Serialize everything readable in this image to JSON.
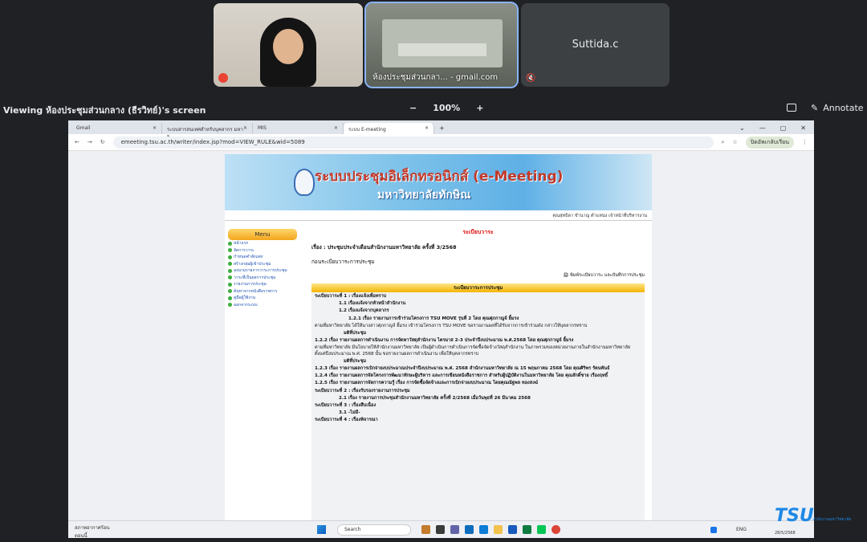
{
  "meet": {
    "tile2_name": "ห้องประชุมส่วนกลา... - gmail.com",
    "tile3_name": "Suttida.c",
    "viewing_text": "Viewing ห้องประชุมส่วนกลาง (ธีรวิทย์)'s screen",
    "zoom_minus": "−",
    "zoom_level": "100%",
    "zoom_plus": "+",
    "annotate_label": "Annotate"
  },
  "browser": {
    "tabs": [
      {
        "label": "Gmail",
        "close": "×"
      },
      {
        "label": "ระบบสารสนเทศสำหรับบุคลากร มหาวิ",
        "close": "×"
      },
      {
        "label": "MIS",
        "close": "×"
      },
      {
        "label": "ระบบ E-meeting",
        "close": "×"
      }
    ],
    "new_tab": "+",
    "win_controls": [
      "⌄",
      "—",
      "▢",
      "✕"
    ],
    "url": "emeeting.tsu.ac.th/writer/index.jsp?mod=VIEW_RULE&wid=5089",
    "profile_pill": "ปิดอัพเกลับเรียน"
  },
  "site": {
    "banner_title": "ระบบประชุมอิเล็กทรอนิกส์ (e-Meeting)",
    "banner_sub": "มหาวิทยาลัยทักษิณ",
    "user_line": "คุณสุทธิดา ชำนาญ ตำแหน่ง เจ้าหน้าที่บริหารงาน",
    "menu_title": "Menu",
    "menu_items": [
      "หน้าแรก",
      "จัดการวาระ",
      "กำหนดคำสั่งแต่ง",
      "สร้างกลุ่มผู้เข้าประชุม",
      "ลงนามรายการวาระการประชุม",
      "วาระที่เป็นผลการประชุม",
      "รายงานการประชุม",
      "ค้นหาจากหนังสือราชการ",
      "คู่มือผู้ใช้งาน",
      "ออกจากระบบ"
    ],
    "page_title": "ระเบียบวาระ",
    "subject": "เรื่อง : ประชุมประจำเดือนสำนักงานมหาวิทยาลัย ครั้งที่ 3/2568",
    "before_agenda": "ก่อนระเบียบวาระการประชุม",
    "print_link": "พิมพ์ระเบียบวาระ และบันทึกการประชุม",
    "agenda_header": "ระเบียบวาระการประชุม",
    "agenda": [
      {
        "text": "ระเบียบวาระที่ 1 : เรื่องแจ้งเพื่อทราบ",
        "indent": 0,
        "bold": true
      },
      {
        "text": "1.1 เรื่องแจ้งจากหัวหน้าสำนักงาน",
        "indent": 30,
        "bold": true
      },
      {
        "text": "1.2 เรื่องแจ้งจากบุคลากร",
        "indent": 30,
        "bold": true
      },
      {
        "text": "1.2.1 เรื่อง รายงานการเข้าร่วมโครงการ TSU MOVE รุ่นที่ 2 โดย คุณศุภกาญจ์ ยิ้มรง",
        "indent": 42,
        "bold": true
      },
      {
        "text": "ตามที่มหาวิทยาลัย ได้ให้นางสาวศุภกาญจ์ ยิ้มรง เข้าร่วมโครงการ TSU MOVE ขอรายงานผลที่ได้รับจากการเข้าร่วมดัง กล่าวให้บุคลากรทราบ",
        "indent": 0,
        "bold": false
      },
      {
        "text": "มติที่ประชุม",
        "indent": 36,
        "bold": true
      },
      {
        "text": "1.2.2 เรื่อง รายงานผลการดำเนินงาน การจัดหาวัสดุสำนักงาน ไตรมาส 2-3 ประจำปีงบประมาณ พ.ศ.2568 โดย คุณศุภกาญจ์ ยิ้มรง",
        "indent": 0,
        "bold": true
      },
      {
        "text": "ตามที่มหาวิทยาลัย มีนโยบายให้สำนักงานมหาวิทยาลัย เป็นผู้ดำเนินการดำเนินการจัดซื้อจัดจ้างวัสดุสำนักงาน ในภาพรวมของหน่วยงานภายในสำนักงานมหาวิทยาลัย ตั้งแต่ปีงบประมาณ พ.ศ. 2568 นั้น ขอรายงานผลการดำเนินงาน เพื่อให้บุคลากรทราบ",
        "indent": 0,
        "bold": false
      },
      {
        "text": "มติที่ประชุม",
        "indent": 36,
        "bold": true
      },
      {
        "text": "1.2.3 เรื่อง รายงานผลการเบิกจ่ายงบประมาณประจำปีงบประมาณ พ.ศ. 2568 สำนักงานมหาวิทยาลัย ณ 15 พฤษภาคม 2568 โดย คุณศิริพร รัตนพันธ์",
        "indent": 0,
        "bold": true
      },
      {
        "text": "1.2.4 เรื่อง รายงานผลการจัดโครงการพัฒนาทักษะผู้บริหาร และการเขียนหนังสือราชการ สำหรับผู้ปฏิบัติงานในมหาวิทยาลัย โดย คุณสักดิ์ชาย เรืองฤทธิ์",
        "indent": 0,
        "bold": true
      },
      {
        "text": "1.2.5 เรื่อง รายงานผลการจัดการความรู้ เรื่อง การจัดซื้อจัดจ้างและการเบิกจ่ายงบประมาณ โดยคุณณัฐพล ทองสงฆ์",
        "indent": 0,
        "bold": true
      },
      {
        "text": "ระเบียบวาระที่ 2 : เรื่องรับรองรายงานการประชุม",
        "indent": 0,
        "bold": true
      },
      {
        "text": "2.1 เรื่อง รายงานการประชุมสำนักงานมหาวิทยาลัย ครั้งที่ 2/2568 เมื่อวันพุธที่ 26 มีนาคม 2568",
        "indent": 30,
        "bold": true
      },
      {
        "text": "ระเบียบวาระที่ 3 : เรื่องสืบเนื่อง",
        "indent": 0,
        "bold": true
      },
      {
        "text": "3.1 -ไม่มี-",
        "indent": 30,
        "bold": true
      },
      {
        "text": "ระเบียบวาระที่ 4 : เรื่องพิจารณา",
        "indent": 0,
        "bold": true
      }
    ]
  },
  "taskbar": {
    "weather": "สภาพอากาศร้อน",
    "weather_sub": "ตอนนี้",
    "search_placeholder": "Search",
    "lang": "ENG",
    "date": "28/5/2568"
  },
  "watermark": {
    "logo": "TSU",
    "sub": "สำนักงานมหาวิทยาลัย"
  }
}
